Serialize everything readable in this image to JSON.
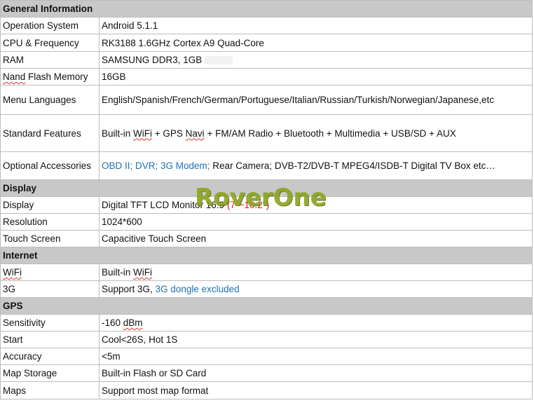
{
  "sections": {
    "general": "General Information",
    "display": "Display",
    "internet": "Internet",
    "gps": "GPS"
  },
  "rows": {
    "os": {
      "label": "Operation System",
      "value": "Android 5.1.1"
    },
    "cpu": {
      "label": "CPU & Frequency",
      "value": "RK3188 1.6GHz Cortex A9 Quad-Core"
    },
    "ram": {
      "label": "RAM",
      "value": "SAMSUNG DDR3, 1GB"
    },
    "nand": {
      "label_a": "Nand",
      "label_b": " Flash Memory",
      "value": "16GB"
    },
    "languages": {
      "label": "Menu Languages",
      "value": "English/Spanish/French/German/Portuguese/Italian/Russian/Turkish/Norwegian/Japanese,etc"
    },
    "features": {
      "label": "Standard Features",
      "value_a": "Built-in ",
      "value_b": "WiFi",
      "value_c": " + GPS ",
      "value_d": "Navi",
      "value_e": " + FM/AM Radio + Bluetooth + Multimedia + USB/SD + AUX"
    },
    "accessories": {
      "label": "Optional Accessories",
      "value_blue": "OBD II; DVR; 3G Modem;",
      "value_rest": " Rear Camera;  DVB-T2/DVB-T MPEG4/ISDB-T Digital TV Box etc…"
    },
    "display": {
      "label": "Display",
      "value_a": "Digital TFT LCD Monitor 16:9 ",
      "value_b": "(7\"~10.2\")"
    },
    "resolution": {
      "label": "Resolution",
      "value": "1024*600"
    },
    "touch": {
      "label": "Touch Screen",
      "value": "Capacitive Touch Screen"
    },
    "wifi": {
      "label": "WiFi",
      "value_a": "Built-in ",
      "value_b": "WiFi"
    },
    "threeg": {
      "label": "3G",
      "value_a": "Support 3G, ",
      "value_b": "3G dongle excluded"
    },
    "sensitivity": {
      "label": "Sensitivity",
      "value_a": "-160 ",
      "value_b": "dBm"
    },
    "start": {
      "label": "Start",
      "value": "Cool<26S, Hot 1S"
    },
    "accuracy": {
      "label": "Accuracy",
      "value": "<5m"
    },
    "map_storage": {
      "label": "Map Storage",
      "value": "Built-in Flash or SD Card"
    },
    "maps": {
      "label": "Maps",
      "value": "Support most map  format"
    }
  },
  "watermark": "RoverOne",
  "colors": {
    "section_bg": "#c8c8c8",
    "red": "#e0141c",
    "blue": "#1f6fb4",
    "watermark": "#8aa41c"
  }
}
